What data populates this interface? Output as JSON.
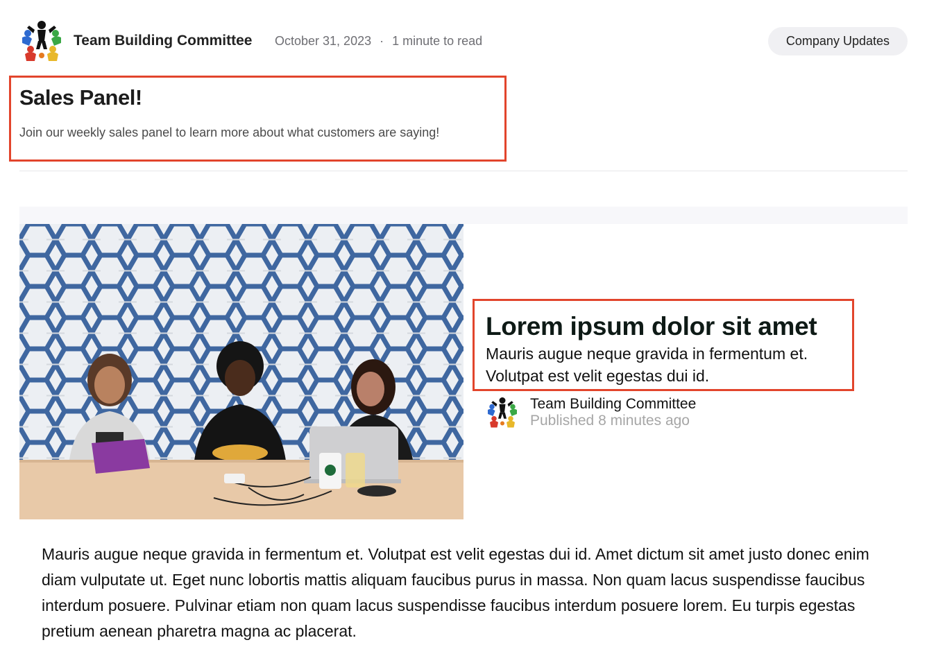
{
  "post": {
    "author": "Team Building Committee",
    "date": "October 31, 2023",
    "separator": "·",
    "read_time": "1 minute to read",
    "category": "Company Updates",
    "title": "Sales Panel!",
    "description": "Join our weekly sales panel to learn more about what customers are saying!"
  },
  "card": {
    "title": "Lorem ipsum dolor sit amet",
    "subtitle": "Mauris augue neque gravida in fermentum et. Volutpat est velit egestas dui id.",
    "author": "Team Building Committee",
    "published": "Published 8 minutes ago"
  },
  "body": {
    "text": "Mauris augue neque gravida in fermentum et. Volutpat est velit egestas dui id. Amet dictum sit amet justo donec enim diam vulputate ut. Eget nunc lobortis mattis aliquam faucibus purus in massa. Non quam lacus suspendisse faucibus interdum posuere. Pulvinar etiam non quam lacus suspendisse faucibus interdum posuere lorem. Eu turpis egestas pretium aenean pharetra magna ac placerat."
  },
  "colors": {
    "highlight_border": "#e2452c",
    "tag_background": "#f0f0f3",
    "meta_text": "#6e6e73",
    "muted_text": "#a6a6a6"
  },
  "icons": {
    "team_logo": "team-circle-logo",
    "hero_image": "meeting-photo"
  }
}
